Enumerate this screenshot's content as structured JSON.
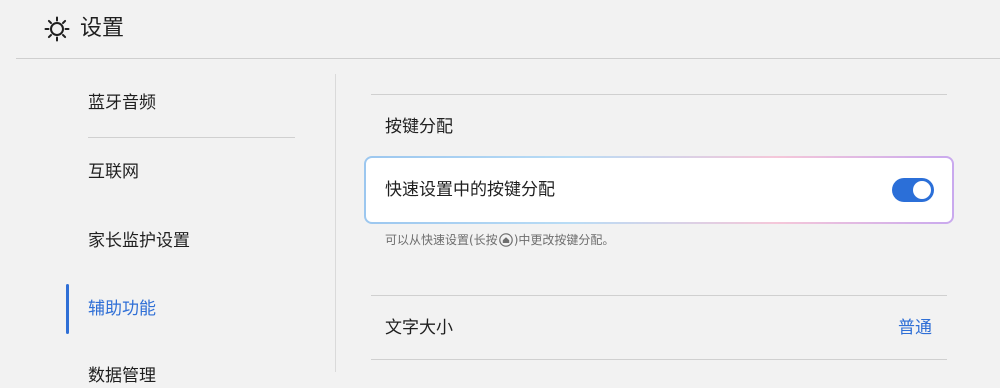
{
  "header": {
    "title": "设置",
    "icon": "gear-icon"
  },
  "sidebar": {
    "items": [
      {
        "label": "蓝牙音频"
      },
      {
        "label": "互联网"
      },
      {
        "label": "家长监护设置"
      },
      {
        "label": "辅助功能",
        "active": true
      },
      {
        "label": "数据管理"
      }
    ]
  },
  "main": {
    "section_title": "按键分配",
    "quick_setting": {
      "label": "快速设置中的按键分配",
      "enabled": true,
      "hint_before": "可以从快速设置(长按",
      "hint_icon": "home-button-icon",
      "hint_after": ")中更改按键分配。"
    },
    "text_size": {
      "label": "文字大小",
      "value": "普通"
    }
  },
  "colors": {
    "accent": "#2f6fd6",
    "toggle_on": "#2b6fd8"
  }
}
